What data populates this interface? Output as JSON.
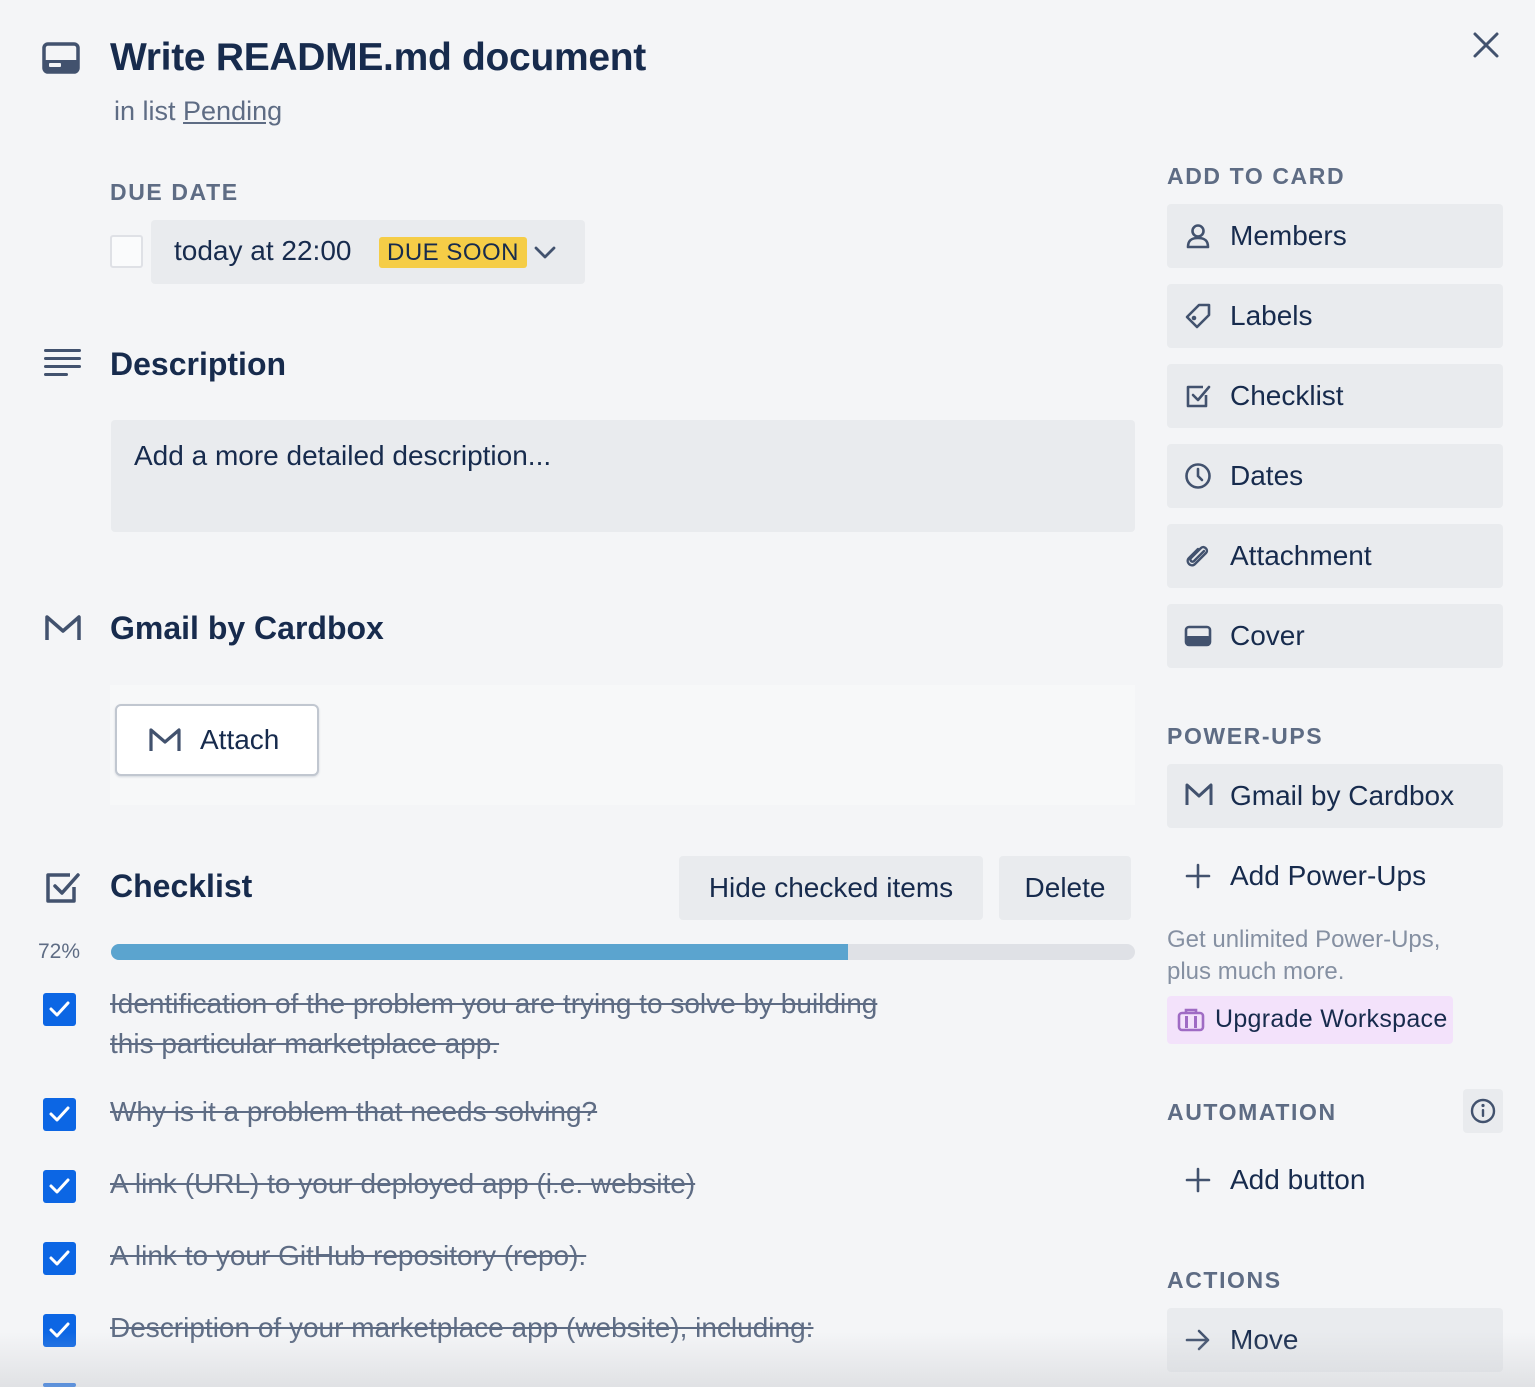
{
  "card": {
    "title": "Write README.md document",
    "in_list_prefix": "in list",
    "list_name": "Pending"
  },
  "due_date": {
    "heading": "DUE DATE",
    "value": "today at 22:00",
    "badge": "DUE SOON",
    "badge_color": "#f5cd47",
    "checked": false
  },
  "description": {
    "title": "Description",
    "placeholder": "Add a more detailed description..."
  },
  "gmail": {
    "title": "Gmail by Cardbox",
    "attach_label": "Attach"
  },
  "checklist": {
    "title": "Checklist",
    "hide_label": "Hide checked items",
    "delete_label": "Delete",
    "progress_text": "72%",
    "progress": 0.72,
    "progress_color": "#5ba4cf",
    "items": [
      {
        "line1": "Identification of the problem you are trying to solve by building",
        "line2": "this particular marketplace app.",
        "checked": true
      },
      {
        "line1": "Why is it a problem that needs solving?",
        "checked": true
      },
      {
        "line1": "A link (URL) to your deployed app (i.e. website)",
        "checked": true
      },
      {
        "line1": "A link to your GitHub repository (repo).",
        "checked": true
      },
      {
        "line1": "Description of your marketplace app (website), including:",
        "checked": true
      }
    ]
  },
  "sidebar": {
    "add_to_card_heading": "ADD TO CARD",
    "add_to_card": [
      {
        "label": "Members",
        "icon": "person-icon"
      },
      {
        "label": "Labels",
        "icon": "tag-icon"
      },
      {
        "label": "Checklist",
        "icon": "checkbox-icon"
      },
      {
        "label": "Dates",
        "icon": "clock-icon"
      },
      {
        "label": "Attachment",
        "icon": "paperclip-icon"
      },
      {
        "label": "Cover",
        "icon": "cover-icon"
      }
    ],
    "powerups_heading": "POWER-UPS",
    "gmail_powerup_label": "Gmail by Cardbox",
    "add_powerups_label": "Add Power-Ups",
    "promo_line1": "Get unlimited Power-Ups,",
    "promo_line2": "plus much more.",
    "upgrade_label": "Upgrade Workspace",
    "automation_heading": "AUTOMATION",
    "add_button_label": "Add button",
    "actions_heading": "ACTIONS",
    "move_label": "Move"
  },
  "colors": {
    "background": "#f4f5f7",
    "button_bg": "#e9ebee",
    "checkbox_checked": "#0c66e4",
    "text_primary": "#172b4d",
    "text_secondary": "#5e6c84",
    "upgrade_bg": "#f3e2fb"
  }
}
